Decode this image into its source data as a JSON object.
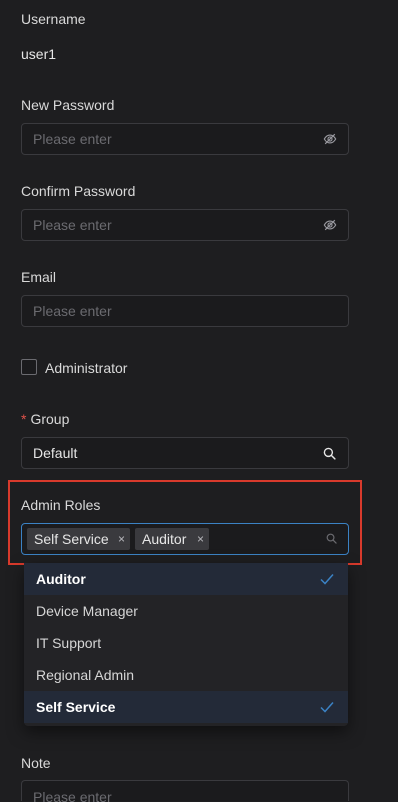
{
  "form": {
    "username_label": "Username",
    "username_value": "user1",
    "new_password_label": "New Password",
    "new_password_placeholder": "Please enter",
    "confirm_password_label": "Confirm Password",
    "confirm_password_placeholder": "Please enter",
    "email_label": "Email",
    "email_placeholder": "Please enter",
    "administrator_label": "Administrator",
    "administrator_checked": false,
    "group_required_mark": "*",
    "group_label": "Group",
    "group_value": "Default",
    "admin_roles_label": "Admin Roles",
    "admin_roles_tags": [
      {
        "label": "Self Service",
        "close": "×"
      },
      {
        "label": "Auditor",
        "close": "×"
      }
    ],
    "admin_roles_options": [
      {
        "label": "Auditor",
        "selected": true
      },
      {
        "label": "Device Manager",
        "selected": false
      },
      {
        "label": "IT Support",
        "selected": false
      },
      {
        "label": "Regional Admin",
        "selected": false
      },
      {
        "label": "Self Service",
        "selected": true
      }
    ],
    "note_label": "Note",
    "note_placeholder": "Please enter"
  },
  "colors": {
    "background": "#1e1e20",
    "accent_blue": "#3b82c4",
    "highlight_red": "#d83a2c",
    "required_red": "#e0524a"
  },
  "icons": {
    "password_toggle": "eye-off-icon",
    "group_search": "search-icon",
    "roles_search": "search-icon",
    "tag_remove": "close-icon",
    "option_selected": "check-icon"
  }
}
